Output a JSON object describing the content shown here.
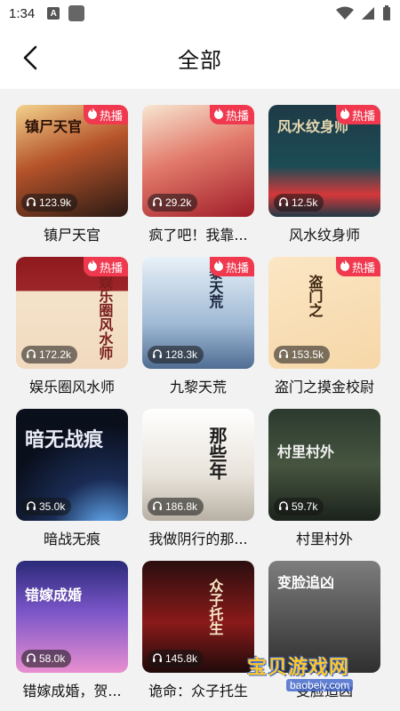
{
  "status_bar": {
    "time": "1:34",
    "a_icon_letter": "A"
  },
  "header": {
    "title": "全部"
  },
  "badge_label": "热播",
  "colors": {
    "hot_badge": "#f0394f",
    "background": "#f2f2f2",
    "watermark": "#ffc828"
  },
  "items": [
    {
      "title": "镇尸天官",
      "plays": "123.9k",
      "hot": true,
      "cover_text": "镇尸天官"
    },
    {
      "title": "疯了吧！我靠...",
      "plays": "29.2k",
      "hot": true,
      "cover_text": ""
    },
    {
      "title": "风水纹身师",
      "plays": "12.5k",
      "hot": true,
      "cover_text": "风水纹身师"
    },
    {
      "title": "娱乐圈风水师",
      "plays": "172.2k",
      "hot": true,
      "cover_text": "娱乐圈风水师"
    },
    {
      "title": "九黎天荒",
      "plays": "128.3k",
      "hot": true,
      "cover_text": "黎天荒"
    },
    {
      "title": "盗门之摸金校尉",
      "plays": "153.5k",
      "hot": true,
      "cover_text": "盗门之"
    },
    {
      "title": "暗战无痕",
      "plays": "35.0k",
      "hot": false,
      "cover_text": "暗无战痕"
    },
    {
      "title": "我做阴行的那...",
      "plays": "186.8k",
      "hot": false,
      "cover_text": "那些年"
    },
    {
      "title": "村里村外",
      "plays": "59.7k",
      "hot": false,
      "cover_text": "村里村外"
    },
    {
      "title": "错嫁成婚，贺...",
      "plays": "58.0k",
      "hot": false,
      "cover_text": "错嫁成婚"
    },
    {
      "title": "诡命：众子托生",
      "plays": "145.8k",
      "hot": false,
      "cover_text": "众子托生"
    },
    {
      "title": "变脸追凶",
      "plays": "",
      "hot": false,
      "cover_text": "变脸追凶"
    }
  ],
  "watermark": {
    "text": "宝贝游戏网",
    "url": "baobeiy.com"
  }
}
